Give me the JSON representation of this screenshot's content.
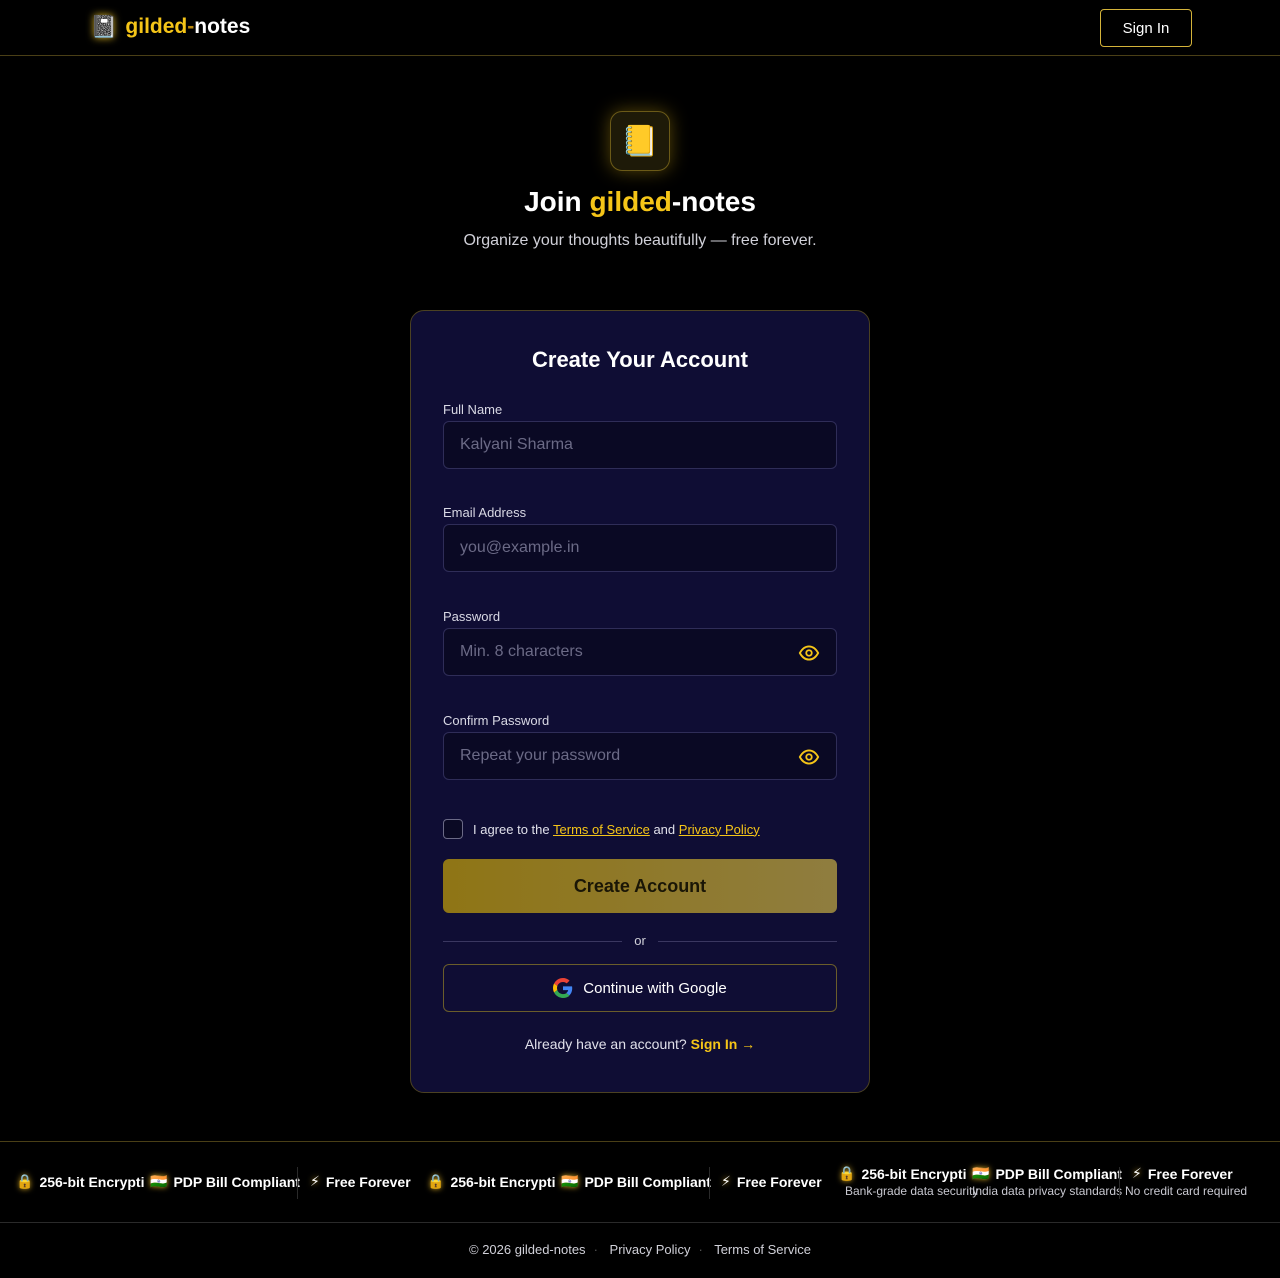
{
  "header": {
    "brand_gold": "gilded",
    "brand_dash": "-",
    "brand_rest": "notes",
    "signin_label": "Sign In"
  },
  "hero": {
    "title_pre": "Join ",
    "title_gold": "gilded",
    "title_post": "-notes",
    "subtitle": "Organize your thoughts beautifully — free forever."
  },
  "form": {
    "title": "Create Your Account",
    "full_name_label": "Full Name",
    "full_name_placeholder": "Kalyani Sharma",
    "email_label": "Email Address",
    "email_placeholder": "you@example.in",
    "password_label": "Password",
    "password_placeholder": "Min. 8 characters",
    "confirm_label": "Confirm Password",
    "confirm_placeholder": "Repeat your password",
    "agree_pre": "I agree to the",
    "terms_link": "Terms of Service",
    "agree_mid": "and",
    "privacy_link": "Privacy Policy",
    "submit_label": "Create Account",
    "divider_text": "or",
    "google_label": "Continue with Google",
    "already_text": "Already have an account?",
    "signin_link": "Sign In →"
  },
  "ticker": {
    "encryption_title": "256-bit Encrypti",
    "encryption_title_full": "256-bit Encrypti",
    "pdp_title": "PDP Bill Compliant",
    "free_title": "Free Forever",
    "encryption_sub": "Bank-grade data security",
    "pdp_sub": "India data privacy standards",
    "free_sub": "No credit card required"
  },
  "footer": {
    "copyright": "© 2026 gilded-notes",
    "privacy": "Privacy Policy",
    "terms": "Terms of Service"
  },
  "colors": {
    "accent": "#f5c518",
    "card_bg": "#0f0d34",
    "page_bg": "#000000"
  }
}
